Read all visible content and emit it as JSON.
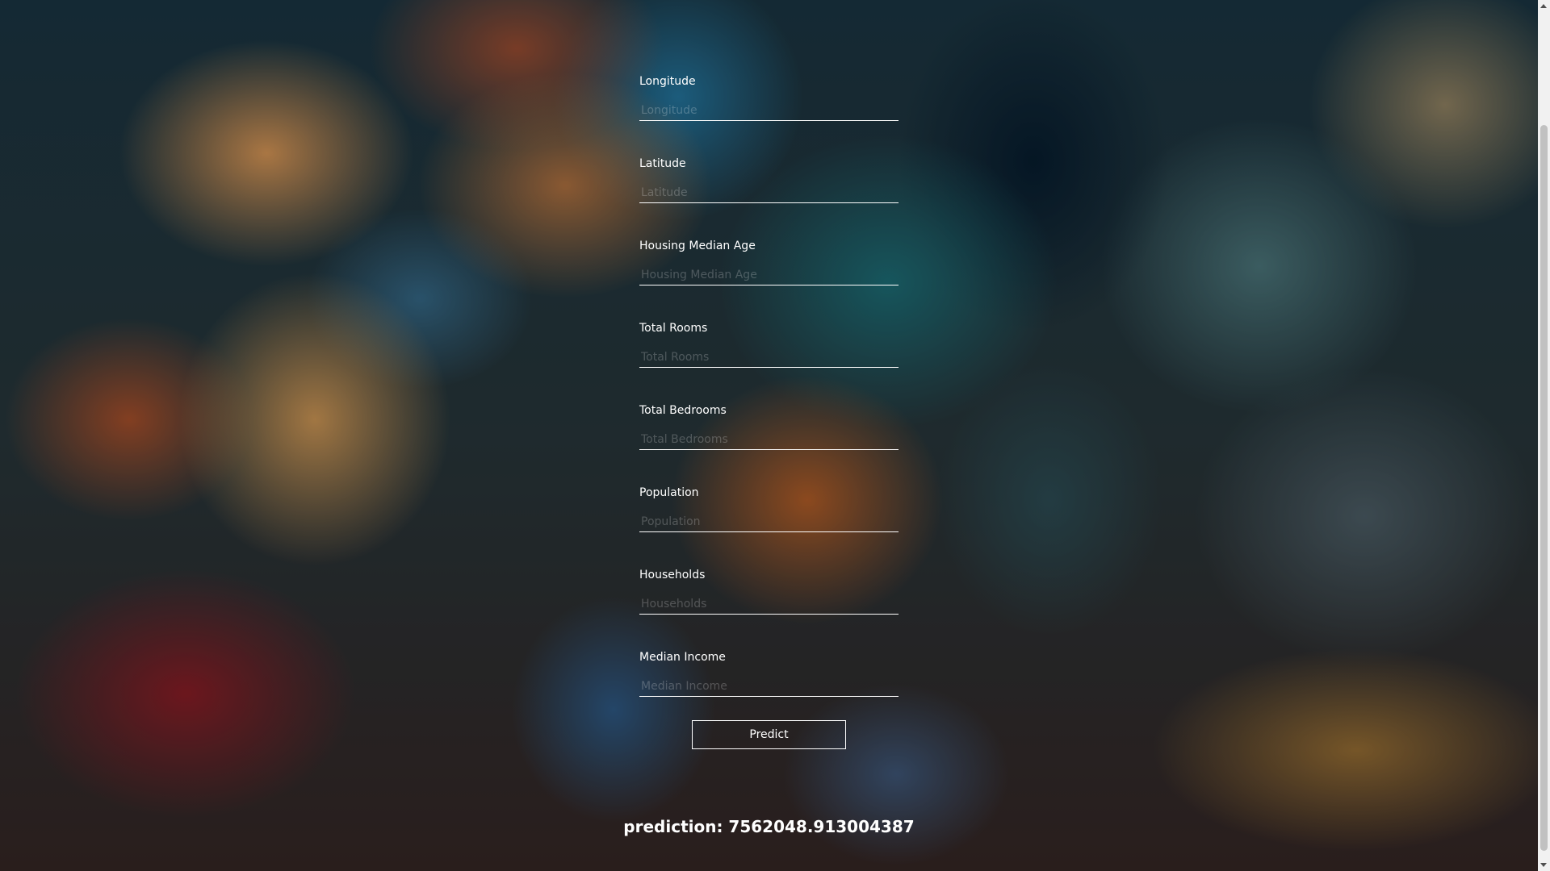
{
  "form": {
    "fields": [
      {
        "label": "Longitude",
        "placeholder": "Longitude",
        "value": ""
      },
      {
        "label": "Latitude",
        "placeholder": "Latitude",
        "value": ""
      },
      {
        "label": "Housing Median Age",
        "placeholder": "Housing Median Age",
        "value": ""
      },
      {
        "label": "Total Rooms",
        "placeholder": "Total Rooms",
        "value": ""
      },
      {
        "label": "Total Bedrooms",
        "placeholder": "Total Bedrooms",
        "value": ""
      },
      {
        "label": "Population",
        "placeholder": "Population",
        "value": ""
      },
      {
        "label": "Households",
        "placeholder": "Households",
        "value": ""
      },
      {
        "label": "Median Income",
        "placeholder": "Median Income",
        "value": ""
      }
    ],
    "predict_label": "Predict"
  },
  "result": {
    "text": "prediction: 7562048.913004387"
  },
  "colors": {
    "text": "#ffffff",
    "input_underline": "#ffffff",
    "scrollbar_track": "#f1f1f1",
    "scrollbar_thumb": "#c1c1c1"
  }
}
